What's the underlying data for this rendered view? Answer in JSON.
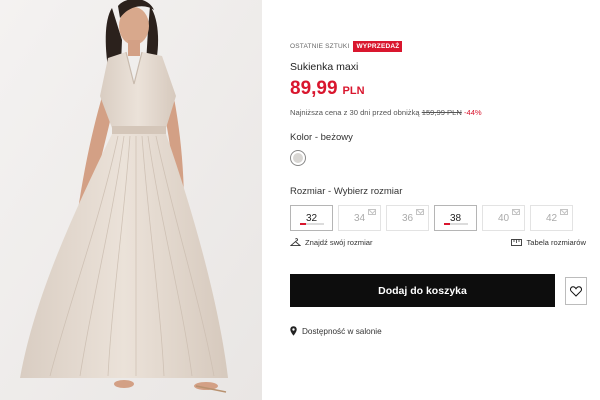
{
  "product": {
    "badge_last_items": "OSTATNIE SZTUKI",
    "badge_sale": "WYPRZEDAŻ",
    "name": "Sukienka maxi",
    "price_value": "89,99",
    "price_currency": "PLN",
    "lowest_price_label": "Najniższa cena z 30 dni przed obniżką",
    "lowest_price_old": "159,99 PLN",
    "lowest_price_discount": "-44%"
  },
  "color": {
    "label": "Kolor",
    "separator": " - ",
    "value": "beżowy",
    "swatch_color": "#d8d6d3"
  },
  "size": {
    "label": "Rozmiar",
    "separator": " - ",
    "prompt": "Wybierz rozmiar",
    "options": [
      {
        "label": "32",
        "available": true,
        "low_stock": true
      },
      {
        "label": "34",
        "available": false
      },
      {
        "label": "36",
        "available": false
      },
      {
        "label": "38",
        "available": true,
        "low_stock": true
      },
      {
        "label": "40",
        "available": false
      },
      {
        "label": "42",
        "available": false
      }
    ]
  },
  "helpers": {
    "find_size": "Znajdź swój rozmiar",
    "size_table": "Tabela rozmiarów"
  },
  "actions": {
    "add_to_cart": "Dodaj do koszyka",
    "wishlist_icon": "heart-icon"
  },
  "availability": {
    "text": "Dostępność w salonie",
    "icon": "location-pin-icon"
  },
  "colors": {
    "accent": "#d9162e",
    "button_bg": "#0d0d0d"
  }
}
